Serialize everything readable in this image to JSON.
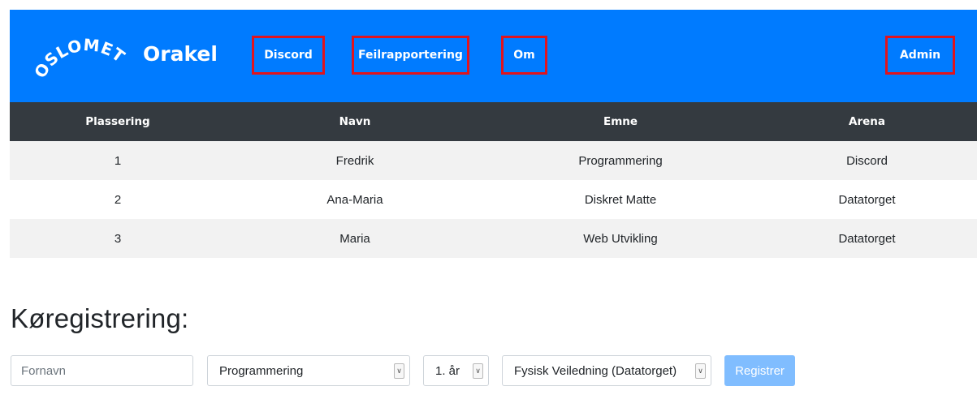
{
  "header": {
    "logo_text": "OSLOMET",
    "brand": "Orakel",
    "nav": {
      "discord": "Discord",
      "feilrapportering": "Feilrapportering",
      "om": "Om",
      "admin": "Admin"
    },
    "colors": {
      "bar": "#007bff",
      "highlight_border": "#e0141e"
    }
  },
  "queue_table": {
    "columns": [
      "Plassering",
      "Navn",
      "Emne",
      "Arena"
    ],
    "rows": [
      [
        "1",
        "Fredrik",
        "Programmering",
        "Discord"
      ],
      [
        "2",
        "Ana-Maria",
        "Diskret Matte",
        "Datatorget"
      ],
      [
        "3",
        "Maria",
        "Web Utvikling",
        "Datatorget"
      ]
    ]
  },
  "registration": {
    "title": "Køregistrering:",
    "fornavn_placeholder": "Fornavn",
    "emne_selected": "Programmering",
    "aar_selected": "1. år",
    "arena_selected": "Fysisk Veiledning (Datatorget)",
    "submit_label": "Registrer"
  }
}
